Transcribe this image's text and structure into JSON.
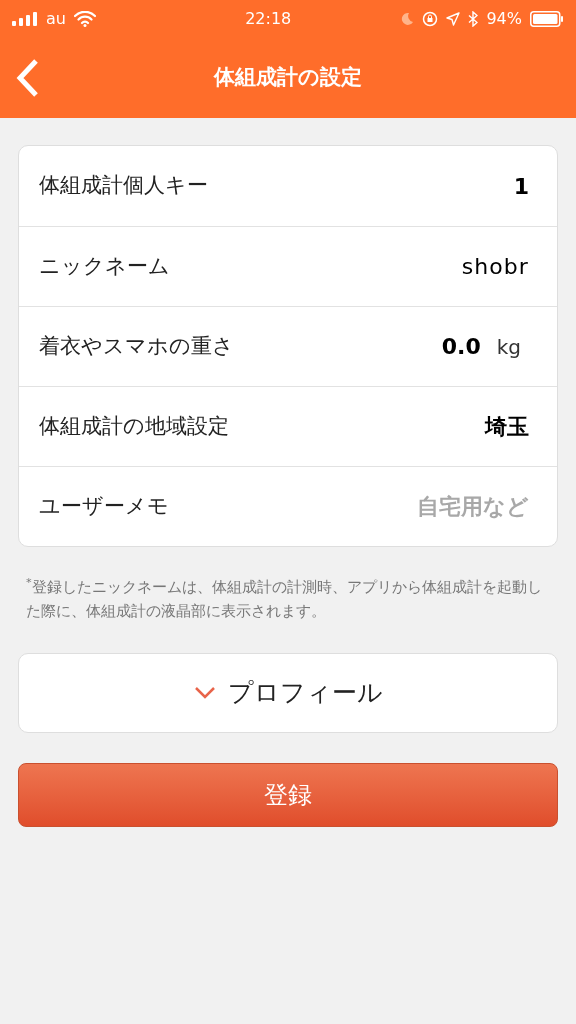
{
  "status_bar": {
    "carrier": "au",
    "time": "22:18",
    "battery": "94%"
  },
  "nav": {
    "title": "体組成計の設定"
  },
  "rows": [
    {
      "label": "体組成計個人キー",
      "kind": "bold",
      "value": "1"
    },
    {
      "label": "ニックネーム",
      "kind": "text",
      "value": "shobr"
    },
    {
      "label": "着衣やスマホの重さ",
      "kind": "unit",
      "value": "0.0",
      "unit": "kg"
    },
    {
      "label": "体組成計の地域設定",
      "kind": "bold",
      "value": "埼玉"
    },
    {
      "label": "ユーザーメモ",
      "kind": "field",
      "placeholder": "自宅用など"
    }
  ],
  "note": "$^{*}$登録したニックネームは、体組成計の計測時、アプリから体組成計を起動した際に、体組成計の液晶部に表示されます。",
  "profile": {
    "label": "プロフィール",
    "expanded": false
  },
  "submit": "登録"
}
